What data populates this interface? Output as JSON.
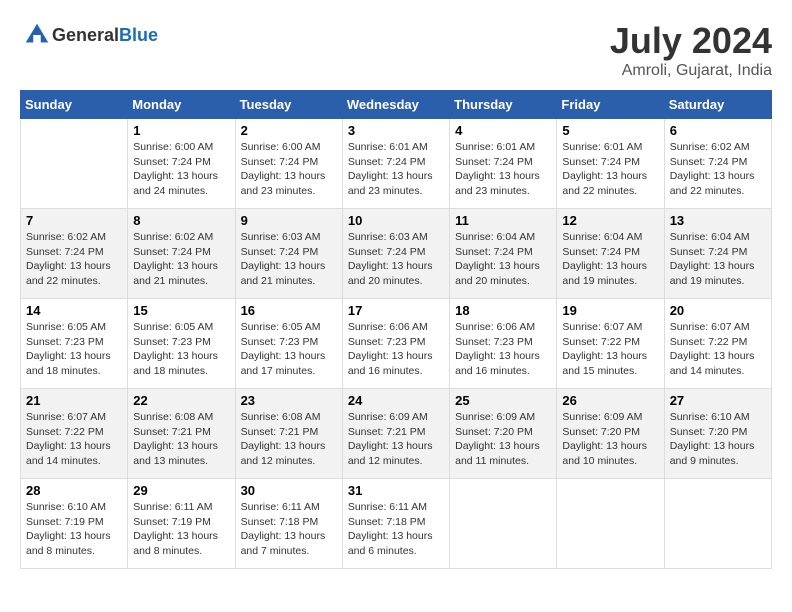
{
  "header": {
    "logo_general": "General",
    "logo_blue": "Blue",
    "title": "July 2024",
    "subtitle": "Amroli, Gujarat, India"
  },
  "days_of_week": [
    "Sunday",
    "Monday",
    "Tuesday",
    "Wednesday",
    "Thursday",
    "Friday",
    "Saturday"
  ],
  "weeks": [
    [
      {
        "day": "",
        "sunrise": "",
        "sunset": "",
        "daylight": ""
      },
      {
        "day": "1",
        "sunrise": "Sunrise: 6:00 AM",
        "sunset": "Sunset: 7:24 PM",
        "daylight": "Daylight: 13 hours and 24 minutes."
      },
      {
        "day": "2",
        "sunrise": "Sunrise: 6:00 AM",
        "sunset": "Sunset: 7:24 PM",
        "daylight": "Daylight: 13 hours and 23 minutes."
      },
      {
        "day": "3",
        "sunrise": "Sunrise: 6:01 AM",
        "sunset": "Sunset: 7:24 PM",
        "daylight": "Daylight: 13 hours and 23 minutes."
      },
      {
        "day": "4",
        "sunrise": "Sunrise: 6:01 AM",
        "sunset": "Sunset: 7:24 PM",
        "daylight": "Daylight: 13 hours and 23 minutes."
      },
      {
        "day": "5",
        "sunrise": "Sunrise: 6:01 AM",
        "sunset": "Sunset: 7:24 PM",
        "daylight": "Daylight: 13 hours and 22 minutes."
      },
      {
        "day": "6",
        "sunrise": "Sunrise: 6:02 AM",
        "sunset": "Sunset: 7:24 PM",
        "daylight": "Daylight: 13 hours and 22 minutes."
      }
    ],
    [
      {
        "day": "7",
        "sunrise": "Sunrise: 6:02 AM",
        "sunset": "Sunset: 7:24 PM",
        "daylight": "Daylight: 13 hours and 22 minutes."
      },
      {
        "day": "8",
        "sunrise": "Sunrise: 6:02 AM",
        "sunset": "Sunset: 7:24 PM",
        "daylight": "Daylight: 13 hours and 21 minutes."
      },
      {
        "day": "9",
        "sunrise": "Sunrise: 6:03 AM",
        "sunset": "Sunset: 7:24 PM",
        "daylight": "Daylight: 13 hours and 21 minutes."
      },
      {
        "day": "10",
        "sunrise": "Sunrise: 6:03 AM",
        "sunset": "Sunset: 7:24 PM",
        "daylight": "Daylight: 13 hours and 20 minutes."
      },
      {
        "day": "11",
        "sunrise": "Sunrise: 6:04 AM",
        "sunset": "Sunset: 7:24 PM",
        "daylight": "Daylight: 13 hours and 20 minutes."
      },
      {
        "day": "12",
        "sunrise": "Sunrise: 6:04 AM",
        "sunset": "Sunset: 7:24 PM",
        "daylight": "Daylight: 13 hours and 19 minutes."
      },
      {
        "day": "13",
        "sunrise": "Sunrise: 6:04 AM",
        "sunset": "Sunset: 7:24 PM",
        "daylight": "Daylight: 13 hours and 19 minutes."
      }
    ],
    [
      {
        "day": "14",
        "sunrise": "Sunrise: 6:05 AM",
        "sunset": "Sunset: 7:23 PM",
        "daylight": "Daylight: 13 hours and 18 minutes."
      },
      {
        "day": "15",
        "sunrise": "Sunrise: 6:05 AM",
        "sunset": "Sunset: 7:23 PM",
        "daylight": "Daylight: 13 hours and 18 minutes."
      },
      {
        "day": "16",
        "sunrise": "Sunrise: 6:05 AM",
        "sunset": "Sunset: 7:23 PM",
        "daylight": "Daylight: 13 hours and 17 minutes."
      },
      {
        "day": "17",
        "sunrise": "Sunrise: 6:06 AM",
        "sunset": "Sunset: 7:23 PM",
        "daylight": "Daylight: 13 hours and 16 minutes."
      },
      {
        "day": "18",
        "sunrise": "Sunrise: 6:06 AM",
        "sunset": "Sunset: 7:23 PM",
        "daylight": "Daylight: 13 hours and 16 minutes."
      },
      {
        "day": "19",
        "sunrise": "Sunrise: 6:07 AM",
        "sunset": "Sunset: 7:22 PM",
        "daylight": "Daylight: 13 hours and 15 minutes."
      },
      {
        "day": "20",
        "sunrise": "Sunrise: 6:07 AM",
        "sunset": "Sunset: 7:22 PM",
        "daylight": "Daylight: 13 hours and 14 minutes."
      }
    ],
    [
      {
        "day": "21",
        "sunrise": "Sunrise: 6:07 AM",
        "sunset": "Sunset: 7:22 PM",
        "daylight": "Daylight: 13 hours and 14 minutes."
      },
      {
        "day": "22",
        "sunrise": "Sunrise: 6:08 AM",
        "sunset": "Sunset: 7:21 PM",
        "daylight": "Daylight: 13 hours and 13 minutes."
      },
      {
        "day": "23",
        "sunrise": "Sunrise: 6:08 AM",
        "sunset": "Sunset: 7:21 PM",
        "daylight": "Daylight: 13 hours and 12 minutes."
      },
      {
        "day": "24",
        "sunrise": "Sunrise: 6:09 AM",
        "sunset": "Sunset: 7:21 PM",
        "daylight": "Daylight: 13 hours and 12 minutes."
      },
      {
        "day": "25",
        "sunrise": "Sunrise: 6:09 AM",
        "sunset": "Sunset: 7:20 PM",
        "daylight": "Daylight: 13 hours and 11 minutes."
      },
      {
        "day": "26",
        "sunrise": "Sunrise: 6:09 AM",
        "sunset": "Sunset: 7:20 PM",
        "daylight": "Daylight: 13 hours and 10 minutes."
      },
      {
        "day": "27",
        "sunrise": "Sunrise: 6:10 AM",
        "sunset": "Sunset: 7:20 PM",
        "daylight": "Daylight: 13 hours and 9 minutes."
      }
    ],
    [
      {
        "day": "28",
        "sunrise": "Sunrise: 6:10 AM",
        "sunset": "Sunset: 7:19 PM",
        "daylight": "Daylight: 13 hours and 8 minutes."
      },
      {
        "day": "29",
        "sunrise": "Sunrise: 6:11 AM",
        "sunset": "Sunset: 7:19 PM",
        "daylight": "Daylight: 13 hours and 8 minutes."
      },
      {
        "day": "30",
        "sunrise": "Sunrise: 6:11 AM",
        "sunset": "Sunset: 7:18 PM",
        "daylight": "Daylight: 13 hours and 7 minutes."
      },
      {
        "day": "31",
        "sunrise": "Sunrise: 6:11 AM",
        "sunset": "Sunset: 7:18 PM",
        "daylight": "Daylight: 13 hours and 6 minutes."
      },
      {
        "day": "",
        "sunrise": "",
        "sunset": "",
        "daylight": ""
      },
      {
        "day": "",
        "sunrise": "",
        "sunset": "",
        "daylight": ""
      },
      {
        "day": "",
        "sunrise": "",
        "sunset": "",
        "daylight": ""
      }
    ]
  ]
}
